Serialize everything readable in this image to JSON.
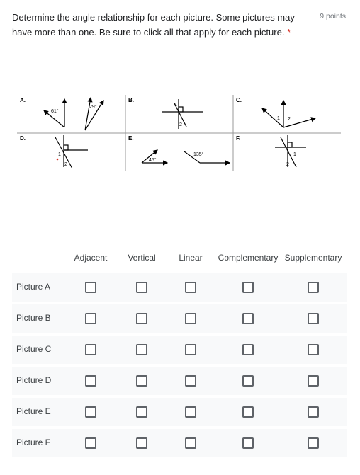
{
  "question": {
    "title": "Determine the angle relationship for each picture. Some pictures may have more than one. Be sure to click all that apply for each picture.",
    "required_marker": "*",
    "points": "9 points"
  },
  "figure": {
    "panel_labels": [
      "A.",
      "B.",
      "C.",
      "D.",
      "E.",
      "F."
    ],
    "angle_labels": {
      "a1": "61°",
      "a2": "29°",
      "c1": "1",
      "c2": "2",
      "b1": "1",
      "b2": "2",
      "d1": "1",
      "d2": "2",
      "e1": "45°",
      "e2": "135°",
      "f1": "1",
      "f2": "2"
    }
  },
  "grid": {
    "columns": [
      "Adjacent",
      "Vertical",
      "Linear",
      "Complementary",
      "Supplementary"
    ],
    "rows": [
      "Picture A",
      "Picture B",
      "Picture C",
      "Picture D",
      "Picture E",
      "Picture F"
    ]
  }
}
